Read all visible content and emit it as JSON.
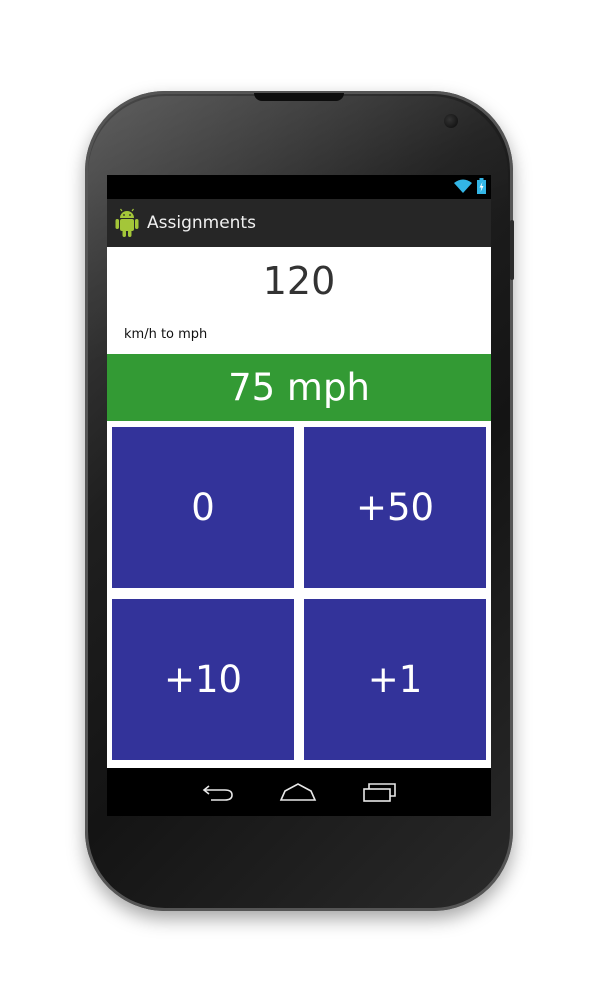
{
  "app": {
    "title": "Assignments",
    "icon": "android-robot-icon"
  },
  "status_bar": {
    "icons": [
      "wifi-icon",
      "battery-charging-icon"
    ]
  },
  "converter": {
    "input_value": "120",
    "mode_label": "km/h to mph",
    "result": "75 mph"
  },
  "buttons": {
    "reset_label": "0",
    "add50_label": "+50",
    "add10_label": "+10",
    "add1_label": "+1"
  },
  "nav_bar": {
    "icons": [
      "back-icon",
      "home-icon",
      "recent-apps-icon"
    ]
  },
  "colors": {
    "result_bg": "#339a34",
    "button_bg": "#33339a",
    "action_bar_bg": "#262626",
    "accent_icon": "#33b5e5"
  }
}
